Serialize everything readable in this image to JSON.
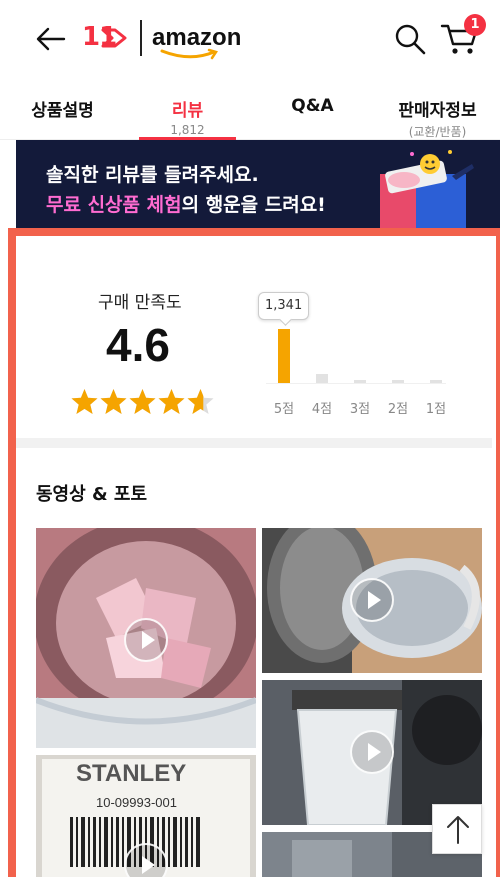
{
  "header": {
    "brand_11st": "11",
    "brand_partner": "amazon",
    "cart_count": "1"
  },
  "tabs": [
    {
      "label": "상품설명",
      "sub": ""
    },
    {
      "label": "리뷰",
      "sub": "1,812"
    },
    {
      "label": "Q&A",
      "sub": ""
    },
    {
      "label": "판매자정보",
      "sub": "(교환/반품)"
    }
  ],
  "banner": {
    "line1": "솔직한 리뷰를 들려주세요.",
    "line2_highlight": "무료 신상품 체험",
    "line2_rest": "의 행운을 드려요!"
  },
  "rating": {
    "title": "구매 만족도",
    "score": "4.6",
    "stars_value": 4.6,
    "stars_max": 5
  },
  "chart_data": {
    "type": "bar",
    "categories": [
      "5점",
      "4점",
      "3점",
      "2점",
      "1점"
    ],
    "values": [
      1341,
      220,
      70,
      30,
      40
    ],
    "highlight_label": "1,341",
    "colors": {
      "highlight": "#f5a400",
      "other": "#e2e2e2"
    }
  },
  "media_section": {
    "title": "동영상 & 포토"
  },
  "colors": {
    "accent": "#f43142",
    "frame": "#f2624c",
    "banner_bg": "#131a3a",
    "star": "#f5a400"
  }
}
